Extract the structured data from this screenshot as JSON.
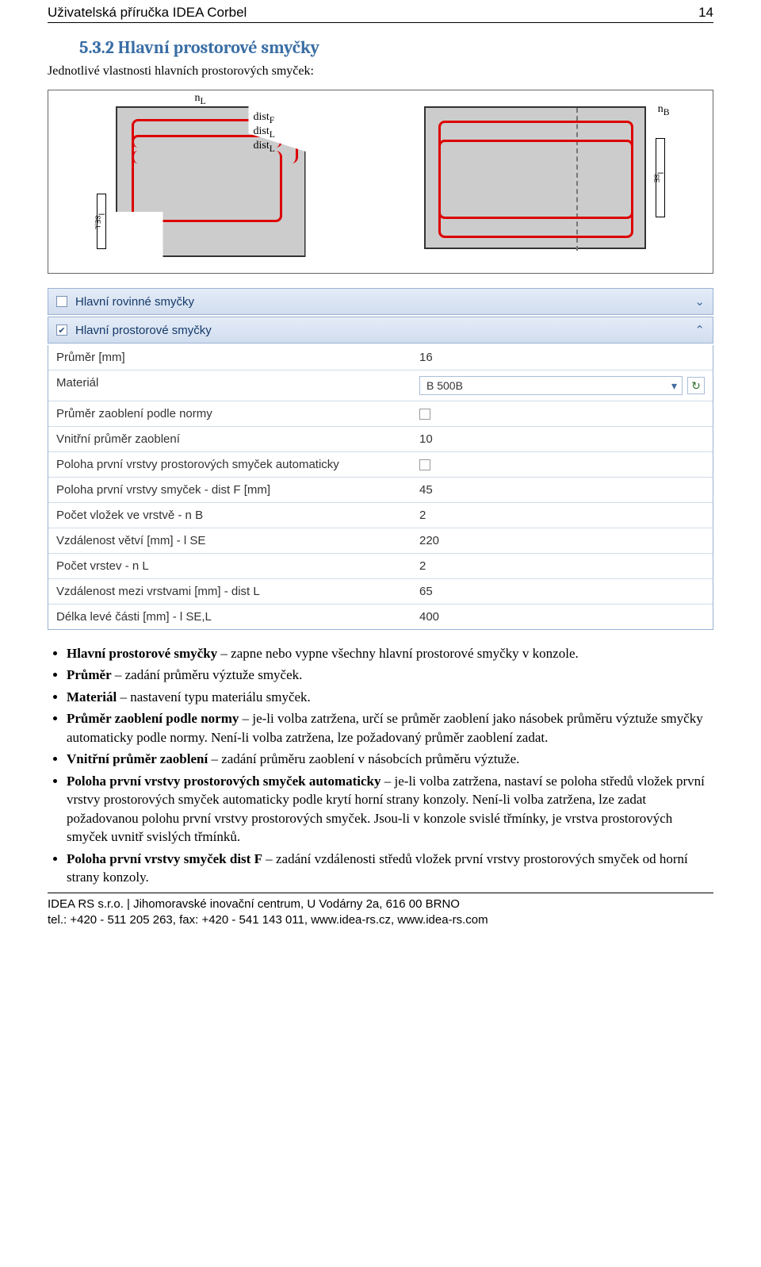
{
  "header": {
    "title": "Uživatelská příručka IDEA Corbel",
    "page_number": "14"
  },
  "section": {
    "number_title": "5.3.2 Hlavní prostorové smyčky",
    "intro": "Jednotlivé vlastnosti hlavních prostorových smyček:"
  },
  "diagram": {
    "nL": "n",
    "nL_sub": "L",
    "nB": "n",
    "nB_sub": "B",
    "distF": "dist",
    "distF_sub": "F",
    "distL1": "dist",
    "distL1_sub": "L",
    "distL2": "dist",
    "distL2_sub": "L",
    "lSEL": "l",
    "lSEL_sub": "SE,L",
    "lSE": "l",
    "lSE_sub": "SE"
  },
  "panels": {
    "planar": {
      "label": "Hlavní rovinné smyčky",
      "checked": false
    },
    "spatial": {
      "label": "Hlavní prostorové smyčky",
      "checked": true
    }
  },
  "props": {
    "prumer": {
      "label": "Průměr [mm]",
      "value": "16"
    },
    "material": {
      "label": "Materiál",
      "value": "B 500B"
    },
    "prumer_zaobleni_norma": {
      "label": "Průměr zaoblení podle normy"
    },
    "vnitrni_prumer": {
      "label": "Vnitřní průměr zaoblení",
      "value": "10"
    },
    "poloha_auto": {
      "label": "Poloha první vrstvy prostorových smyček automaticky"
    },
    "poloha_distF": {
      "label": "Poloha první vrstvy smyček - dist F [mm]",
      "value": "45"
    },
    "pocet_vlozek": {
      "label": "Počet vložek ve vrstvě - n B",
      "value": "2"
    },
    "vzdalenost_vetvi": {
      "label": "Vzdálenost větví [mm] - l SE",
      "value": "220"
    },
    "pocet_vrstev": {
      "label": "Počet vrstev - n L",
      "value": "2"
    },
    "vzdalenost_vrstvami": {
      "label": "Vzdálenost mezi vrstvami [mm] - dist L",
      "value": "65"
    },
    "delka_leve": {
      "label": "Délka levé části [mm] - l SE,L",
      "value": "400"
    }
  },
  "bullets": {
    "b1a": "Hlavní prostorové smyčky",
    "b1b": " – zapne nebo vypne všechny hlavní prostorové smyčky v konzole.",
    "b2a": "Průměr",
    "b2b": " – zadání průměru výztuže smyček.",
    "b3a": "Materiál",
    "b3b": " – nastavení typu materiálu smyček.",
    "b4a": "Průměr zaoblení podle normy",
    "b4b": " – je-li volba zatržena, určí se průměr zaoblení jako násobek průměru výztuže smyčky automaticky podle normy. Není-li volba zatržena, lze požadovaný průměr zaoblení zadat.",
    "b5a": "Vnitřní průměr zaoblení",
    "b5b": " – zadání průměru zaoblení v násobcích průměru výztuže.",
    "b6a": "Poloha první vrstvy prostorových smyček automaticky",
    "b6b": " – je-li volba zatržena, nastaví se poloha středů vložek první vrstvy prostorových smyček automaticky podle krytí horní strany konzoly. Není-li volba zatržena, lze zadat požadovanou polohu první vrstvy prostorových smyček. Jsou-li v konzole svislé třmínky, je vrstva prostorových smyček uvnitř svislých třmínků.",
    "b7a": "Poloha první vrstvy smyček dist F",
    "b7b": " – zadání vzdálenosti středů vložek první vrstvy prostorových smyček od horní strany konzoly."
  },
  "footer": {
    "line1": "IDEA RS s.r.o. | Jihomoravské inovační centrum, U Vodárny 2a, 616 00 BRNO",
    "line2": "tel.: +420 - 511 205 263, fax: +420 - 541 143 011, www.idea-rs.cz, www.idea-rs.com"
  }
}
